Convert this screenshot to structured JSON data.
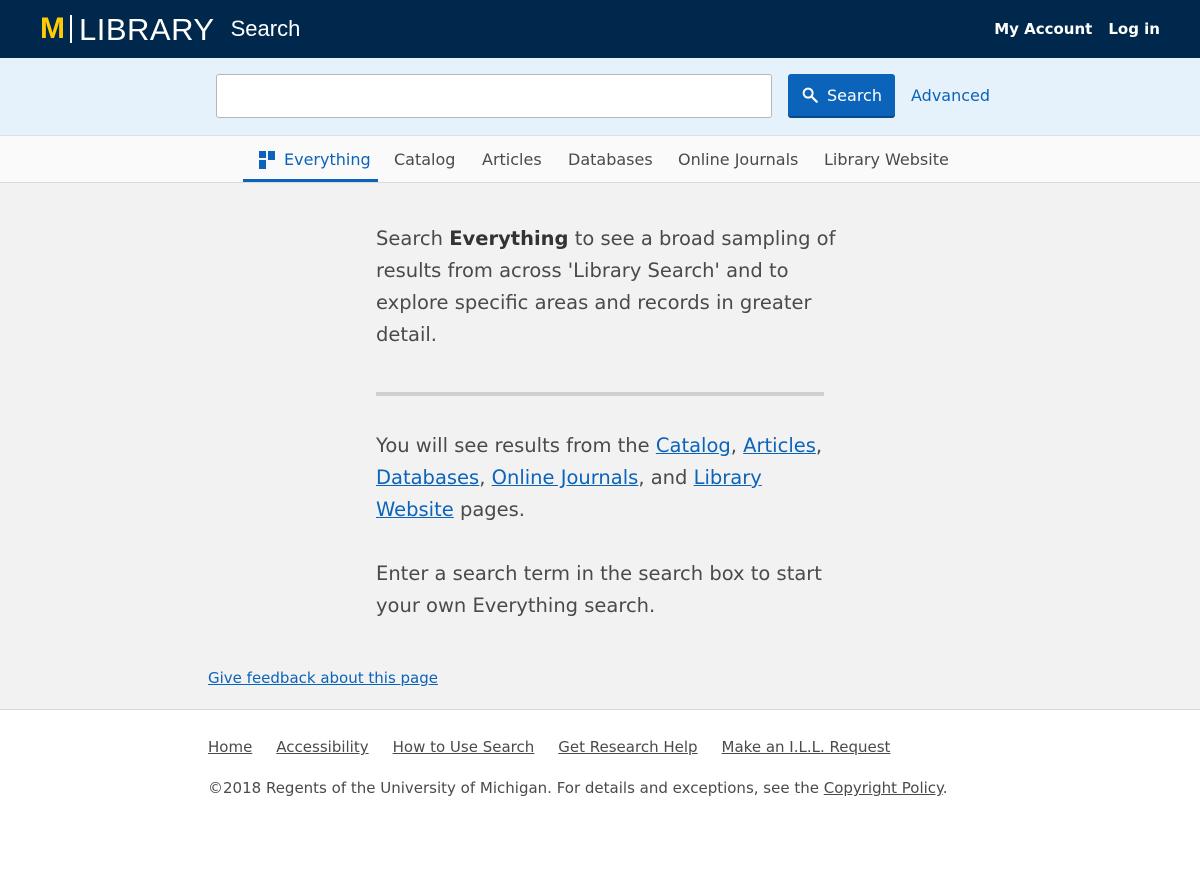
{
  "header": {
    "logo_m": "M",
    "logo_library": "LIBRARY",
    "app_name": "Search",
    "my_account": "My Account",
    "log_in": "Log in"
  },
  "search": {
    "input_value": "",
    "button_label": "Search",
    "advanced_label": "Advanced"
  },
  "tabs": [
    {
      "label": "Everything",
      "active": true
    },
    {
      "label": "Catalog"
    },
    {
      "label": "Articles"
    },
    {
      "label": "Databases"
    },
    {
      "label": "Online Journals"
    },
    {
      "label": "Library Website"
    }
  ],
  "main": {
    "intro_prefix": "Search ",
    "intro_bold": "Everything",
    "intro_suffix": " to see a broad sampling of results from across 'Library Search' and to explore specific areas and records in greater detail.",
    "results_prefix": "You will see results from the ",
    "link_catalog": "Catalog",
    "link_articles": "Articles",
    "link_databases": "Databases",
    "link_online_journals": "Online Journals",
    "link_library_website": "Library Website",
    "sep_comma": ",",
    "sep_and": ", and ",
    "results_suffix": "pages.",
    "hint": "Enter a search term in the search box to start your own Everything search.",
    "feedback_link": "Give feedback about this page"
  },
  "footer": {
    "links": [
      "Home",
      "Accessibility",
      "How to Use Search",
      "Get Research Help",
      "Make an I.L.L. Request"
    ],
    "copyright_text": "©2018 Regents of the University of Michigan. For details and exceptions, see the ",
    "copyright_link": "Copyright Policy",
    "copyright_end": "."
  },
  "colors": {
    "header_bg": "#00274c",
    "maize": "#ffcb05",
    "link_blue": "#0b64b9",
    "search_band_bg": "#e5f1fb",
    "main_bg": "#f2f2f2"
  }
}
